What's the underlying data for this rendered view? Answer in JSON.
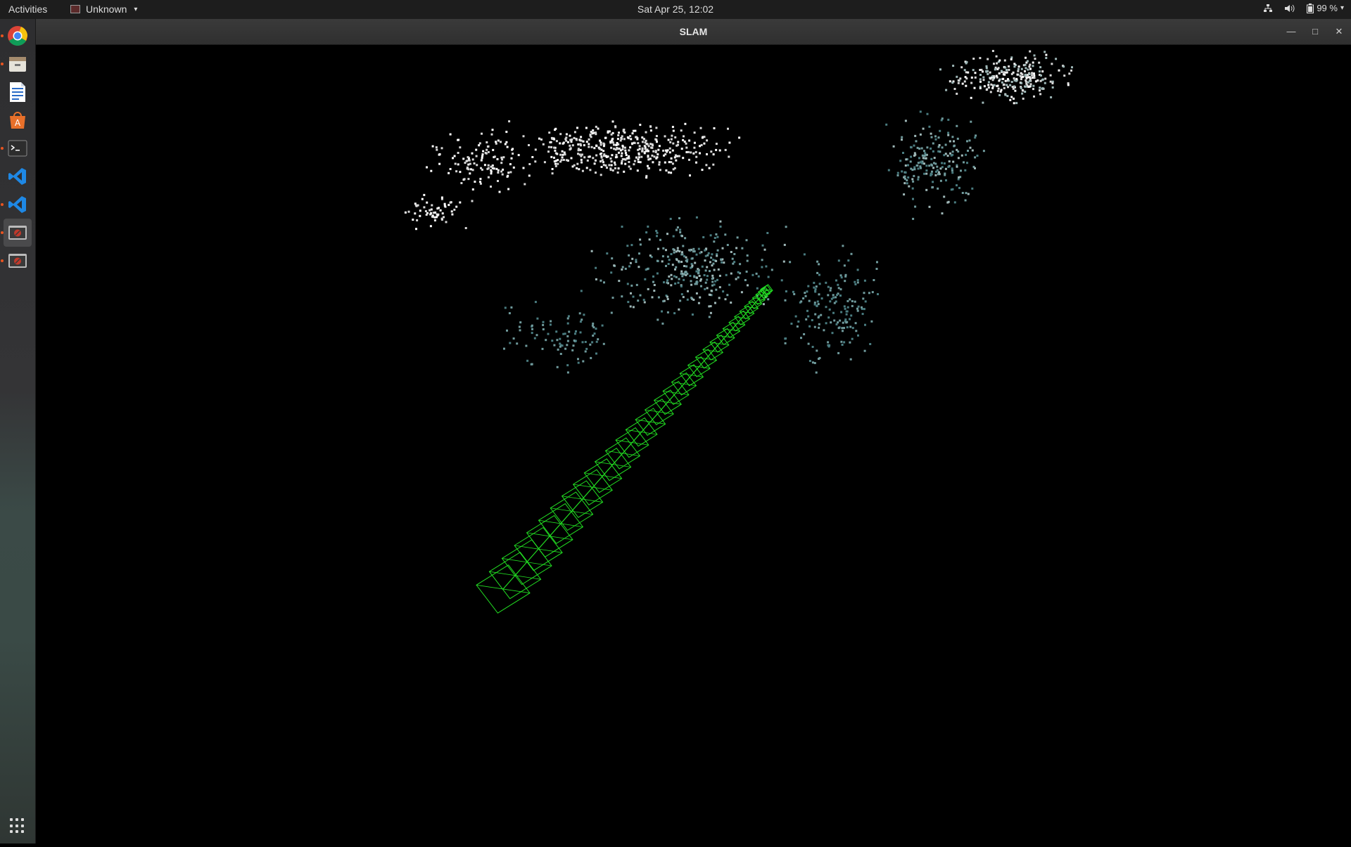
{
  "topbar": {
    "activities": "Activities",
    "app_name": "Unknown",
    "clock": "Sat Apr 25, 12:02",
    "battery": "99 %"
  },
  "dock": {
    "items": [
      {
        "name": "chrome-icon",
        "active": false,
        "running": true
      },
      {
        "name": "files-icon",
        "active": false,
        "running": true
      },
      {
        "name": "writer-icon",
        "active": false,
        "running": false
      },
      {
        "name": "software-center-icon",
        "active": false,
        "running": false
      },
      {
        "name": "terminal-icon",
        "active": false,
        "running": true
      },
      {
        "name": "vscode-icon",
        "active": false,
        "running": false
      },
      {
        "name": "vscode-icon",
        "active": false,
        "running": true
      },
      {
        "name": "slam-app-icon",
        "active": true,
        "running": true
      },
      {
        "name": "slam-app-icon",
        "active": false,
        "running": true
      }
    ],
    "show_apps_icon": "grid-icon"
  },
  "window": {
    "title": "SLAM",
    "controls": [
      "minimize-icon",
      "maximize-icon",
      "close-icon"
    ]
  },
  "viewer": {
    "background": "#000000",
    "trajectory_color": "#22dd22",
    "point_colors": [
      "#ffffff",
      "#d8d8d8",
      "#9fb8b8",
      "#6f9a9c",
      "#4a7c80"
    ]
  }
}
